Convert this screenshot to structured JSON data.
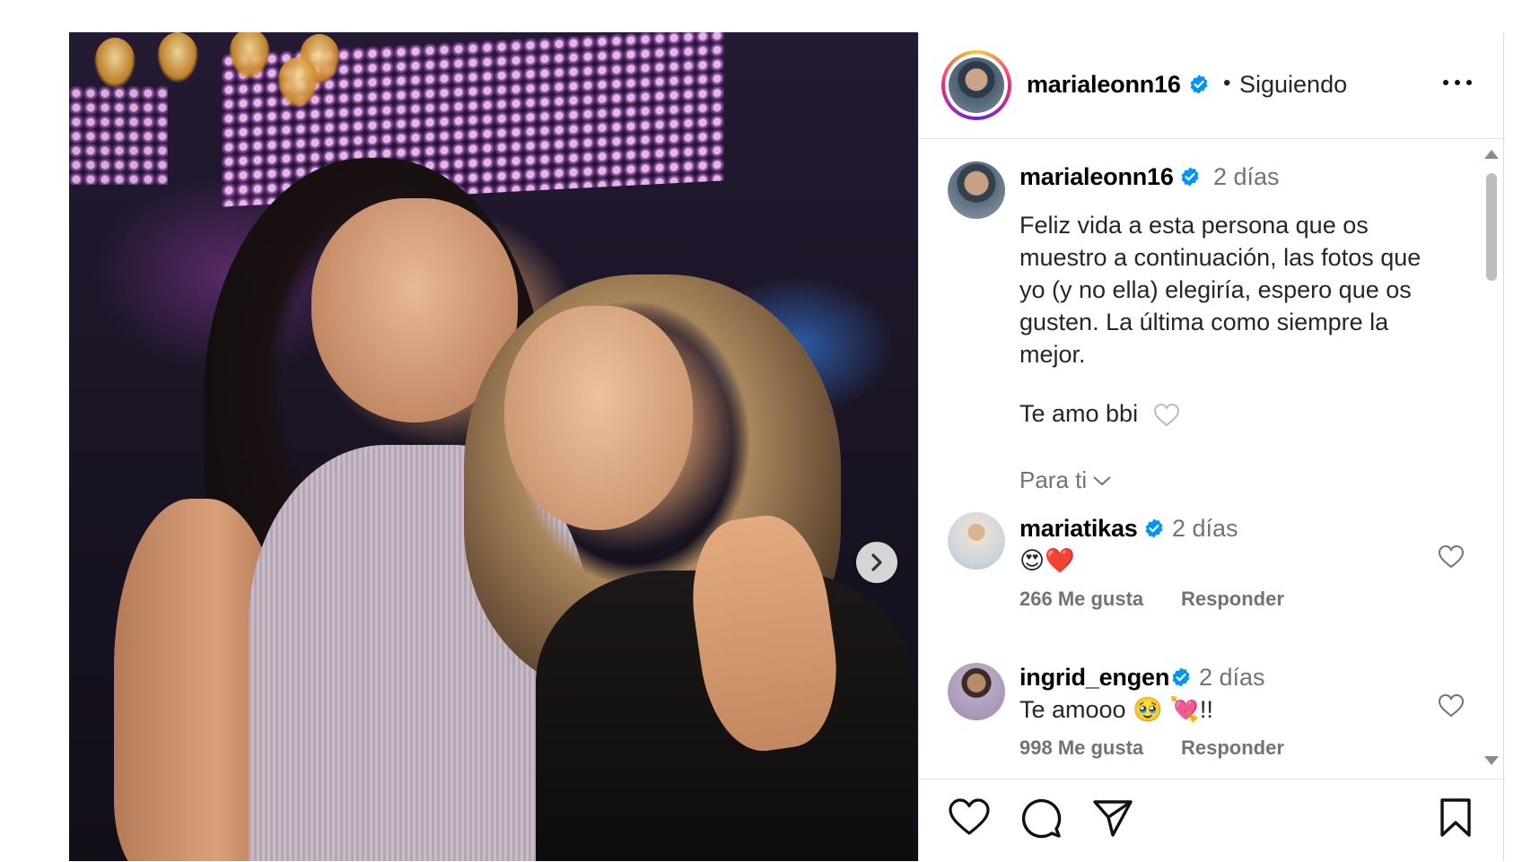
{
  "post": {
    "username": "marialeonn16",
    "separator": "•",
    "follow_status": "Siguiendo"
  },
  "caption": {
    "username": "marialeonn16",
    "time": "2 días",
    "lines": [
      "Feliz vida a esta persona que os",
      "muestro a continuación, las fotos que",
      "yo (y no ella) elegiría, espero que os",
      "gusten. La última como siempre la",
      "mejor."
    ],
    "closing": "Te amo bbi"
  },
  "translation_toggle": "Para ti",
  "comments": [
    {
      "username": "mariatikas",
      "time": "2 días",
      "text": "😍❤️",
      "likes": "266 Me gusta",
      "reply": "Responder"
    },
    {
      "username": "ingrid_engen",
      "time": "2 días",
      "text": "Te amooo 🥹 💘!!",
      "likes": "998 Me gusta",
      "reply": "Responder"
    }
  ],
  "colors": {
    "verified": "#0095f6",
    "muted_text": "#737373"
  },
  "icons": {
    "verified": "verified-badge-icon",
    "more": "more-options-icon",
    "next": "chevron-right-icon",
    "like": "heart-icon",
    "comment": "comment-bubble-icon",
    "share": "paper-plane-icon",
    "save": "bookmark-icon"
  }
}
